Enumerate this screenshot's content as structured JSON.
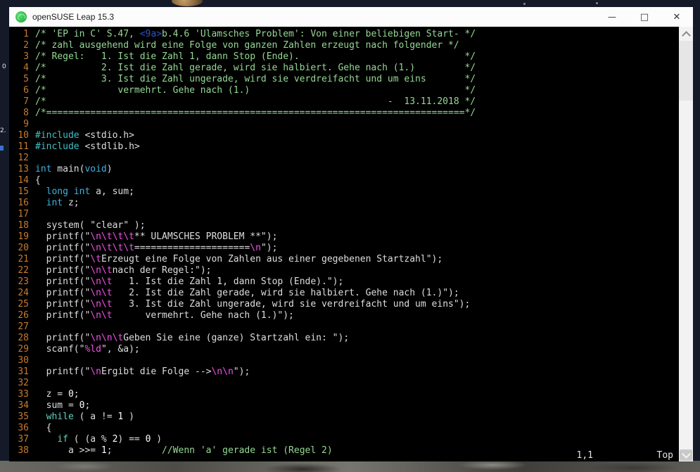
{
  "window": {
    "title": "openSUSE Leap 15.3",
    "controls": {
      "minimize": "—",
      "maximize": "□",
      "close": "✕"
    }
  },
  "colors": {
    "titlebar_bg": "#fcfcfc",
    "terminal_bg": "#000000",
    "comment": "#94d894",
    "type": "#41b0e0",
    "preproc": "#3fc0c8",
    "statement": "#63cfc0",
    "plain": "#dedede",
    "string_escape": "#ef52e5",
    "special_key": "#2e54cc",
    "line_number": "#c87a30",
    "app_icon_green": "#2fbe4b"
  },
  "editor": {
    "status": {
      "ruler": "1,1",
      "position": "Top"
    },
    "lines": [
      [
        [
          "c",
          "/* 'EP in C' S.47, "
        ],
        [
          "k",
          "<9a>"
        ],
        [
          "c",
          "b.4.6 'Ulamsches Problem': Von einer beliebigen Start- */"
        ]
      ],
      [
        [
          "c",
          "/* zahl ausgehend wird eine Folge von ganzen Zahlen erzeugt nach folgender */"
        ]
      ],
      [
        [
          "c",
          "/* Regel:   1. Ist die Zahl 1, dann Stop (Ende).                              */"
        ]
      ],
      [
        [
          "c",
          "/*          2. Ist die Zahl gerade, wird sie halbiert. Gehe nach (1.)         */"
        ]
      ],
      [
        [
          "c",
          "/*          3. Ist die Zahl ungerade, wird sie verdreifacht und um eins       */"
        ]
      ],
      [
        [
          "c",
          "/*             vermehrt. Gehe nach (1.)                                       */"
        ]
      ],
      [
        [
          "c",
          "/*                                                              -  13.11.2018 */"
        ]
      ],
      [
        [
          "c",
          "/*============================================================================*/"
        ]
      ],
      [],
      [
        [
          "d",
          "#include"
        ],
        [
          "p",
          " <stdio.h>"
        ]
      ],
      [
        [
          "d",
          "#include"
        ],
        [
          "p",
          " <stdlib.h>"
        ]
      ],
      [],
      [
        [
          "t",
          "int"
        ],
        [
          "p",
          " main("
        ],
        [
          "t",
          "void"
        ],
        [
          "p",
          ")"
        ]
      ],
      [
        [
          "p",
          "{"
        ]
      ],
      [
        [
          "p",
          "  "
        ],
        [
          "t",
          "long"
        ],
        [
          "p",
          " "
        ],
        [
          "t",
          "int"
        ],
        [
          "p",
          " a, sum;"
        ]
      ],
      [
        [
          "p",
          "  "
        ],
        [
          "t",
          "int"
        ],
        [
          "p",
          " z;"
        ]
      ],
      [],
      [
        [
          "p",
          "  system( \"clear\" );"
        ]
      ],
      [
        [
          "p",
          "  printf(\""
        ],
        [
          "e",
          "\\n\\t\\t\\t"
        ],
        [
          "p",
          "** ULAMSCHES PROBLEM **\");"
        ]
      ],
      [
        [
          "p",
          "  printf(\""
        ],
        [
          "e",
          "\\n\\t\\t\\t"
        ],
        [
          "p",
          "====================="
        ],
        [
          "e",
          "\\n"
        ],
        [
          "p",
          "\");"
        ]
      ],
      [
        [
          "p",
          "  printf(\""
        ],
        [
          "e",
          "\\t"
        ],
        [
          "p",
          "Erzeugt eine Folge von Zahlen aus einer gegebenen Startzahl\");"
        ]
      ],
      [
        [
          "p",
          "  printf(\""
        ],
        [
          "e",
          "\\n\\t"
        ],
        [
          "p",
          "nach der Regel:\");"
        ]
      ],
      [
        [
          "p",
          "  printf(\""
        ],
        [
          "e",
          "\\n\\t"
        ],
        [
          "p",
          "   1. Ist die Zahl 1, dann Stop (Ende).\");"
        ]
      ],
      [
        [
          "p",
          "  printf(\""
        ],
        [
          "e",
          "\\n\\t"
        ],
        [
          "p",
          "   2. Ist die Zahl gerade, wird sie halbiert. Gehe nach (1.)\");"
        ]
      ],
      [
        [
          "p",
          "  printf(\""
        ],
        [
          "e",
          "\\n\\t"
        ],
        [
          "p",
          "   3. Ist die Zahl ungerade, wird sie verdreifacht und um eins\");"
        ]
      ],
      [
        [
          "p",
          "  printf(\""
        ],
        [
          "e",
          "\\n\\t"
        ],
        [
          "p",
          "      vermehrt. Gehe nach (1.)\");"
        ]
      ],
      [],
      [
        [
          "p",
          "  printf(\""
        ],
        [
          "e",
          "\\n\\n\\t"
        ],
        [
          "p",
          "Geben Sie eine (ganze) Startzahl ein: \");"
        ]
      ],
      [
        [
          "p",
          "  scanf(\""
        ],
        [
          "e",
          "%ld"
        ],
        [
          "p",
          "\", &a);"
        ]
      ],
      [],
      [
        [
          "p",
          "  printf(\""
        ],
        [
          "e",
          "\\n"
        ],
        [
          "p",
          "Ergibt die Folge -->"
        ],
        [
          "e",
          "\\n\\n"
        ],
        [
          "p",
          "\");"
        ]
      ],
      [],
      [
        [
          "p",
          "  z = "
        ],
        [
          "n",
          "0"
        ],
        [
          "p",
          ";"
        ]
      ],
      [
        [
          "p",
          "  sum = "
        ],
        [
          "n",
          "0"
        ],
        [
          "p",
          ";"
        ]
      ],
      [
        [
          "p",
          "  "
        ],
        [
          "s",
          "while"
        ],
        [
          "p",
          " ( a != "
        ],
        [
          "n",
          "1"
        ],
        [
          "p",
          " )"
        ]
      ],
      [
        [
          "p",
          "  {"
        ]
      ],
      [
        [
          "p",
          "    "
        ],
        [
          "s",
          "if"
        ],
        [
          "p",
          " ( (a % "
        ],
        [
          "n",
          "2"
        ],
        [
          "p",
          ") == "
        ],
        [
          "n",
          "0"
        ],
        [
          "p",
          " )"
        ]
      ],
      [
        [
          "p",
          "      a >>= "
        ],
        [
          "n",
          "1"
        ],
        [
          "p",
          ";         "
        ],
        [
          "c",
          "//Wenn 'a' gerade ist (Regel 2)"
        ]
      ]
    ]
  },
  "desktop": {
    "fragments": {
      "icon_label_1": "0",
      "icon_label_2": "2."
    }
  }
}
